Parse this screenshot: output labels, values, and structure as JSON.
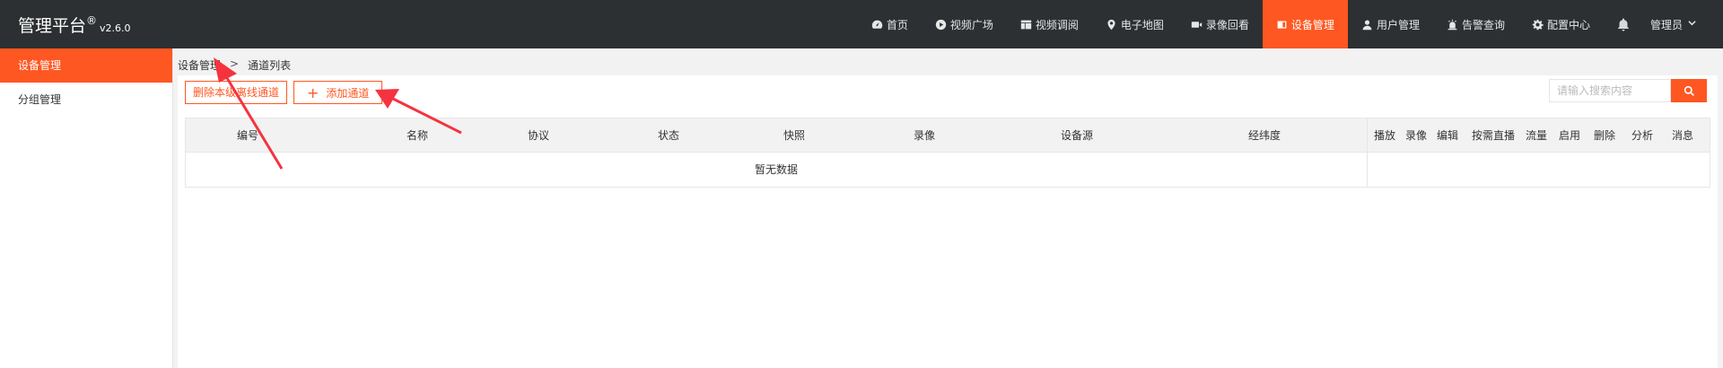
{
  "header": {
    "title": "管理平台",
    "reg_mark": "®",
    "version": "v2.6.0",
    "nav": [
      {
        "label": "首页",
        "icon": "dashboard-icon"
      },
      {
        "label": "视频广场",
        "icon": "play-circle-icon"
      },
      {
        "label": "视频调阅",
        "icon": "layout-icon"
      },
      {
        "label": "电子地图",
        "icon": "location-pin-icon"
      },
      {
        "label": "录像回看",
        "icon": "video-camera-icon"
      },
      {
        "label": "设备管理",
        "icon": "device-icon",
        "active": true
      },
      {
        "label": "用户管理",
        "icon": "user-icon"
      },
      {
        "label": "告警查询",
        "icon": "alarm-icon"
      },
      {
        "label": "配置中心",
        "icon": "gear-icon"
      }
    ],
    "bell_icon": "bell-icon",
    "user": "管理员",
    "user_caret": "chevron-down-icon"
  },
  "sidebar": {
    "items": [
      {
        "label": "设备管理",
        "active": true
      },
      {
        "label": "分组管理",
        "active": false
      }
    ]
  },
  "breadcrumb": {
    "parent": "设备管理",
    "separator": ">",
    "current": "通道列表"
  },
  "toolbar": {
    "delete_offline_label": "删除本级离线通道",
    "add_channel_label": "添加通道",
    "add_icon": "plus-icon",
    "search_placeholder": "请输入搜索内容",
    "search_icon": "search-icon"
  },
  "table": {
    "columns": [
      "编号",
      "名称",
      "协议",
      "状态",
      "快照",
      "录像",
      "设备源",
      "经纬度"
    ],
    "action_columns": [
      "播放",
      "录像",
      "编辑",
      "按需直播",
      "流量",
      "启用",
      "删除",
      "分析",
      "消息"
    ],
    "empty_text": "暂无数据"
  },
  "colors": {
    "accent": "#ff5722",
    "header_bg": "#2d3032",
    "annotation": "#f5333f"
  }
}
